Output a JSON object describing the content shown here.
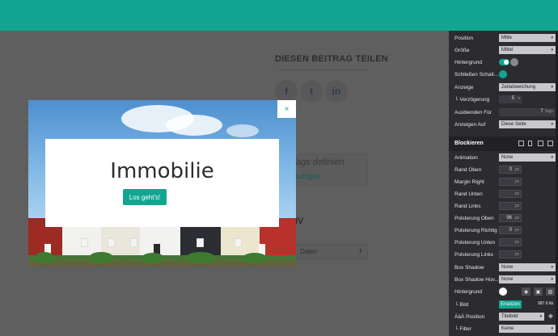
{
  "page": {
    "share_title": "DIESEN BEITRAG TEILEN",
    "social": [
      "f",
      "t",
      "in"
    ],
    "no_tags": "ne Tags definiert",
    "add_tags": "e hinzufügen",
    "section_iv": "IV",
    "select_value": "Daten",
    "select_arrow": "⇕"
  },
  "popup": {
    "title": "Immobilie",
    "cta": "Los geht's!",
    "close": "×"
  },
  "panel": {
    "rows": {
      "position": {
        "label": "Position",
        "value": "Mitte"
      },
      "size": {
        "label": "Größe",
        "value": "Mittel"
      },
      "background": {
        "label": "Hintergrund"
      },
      "close_btn": {
        "label": "Schließen Schalt..."
      },
      "display": {
        "label": "Anzeige",
        "value": "Zeitabweichung"
      },
      "delay": {
        "label": "└ Verzögerung",
        "value": "5",
        "unit": "s"
      },
      "hide_for": {
        "label": "Ausblenden Für",
        "value": "7",
        "unit": "Tags"
      },
      "show_on": {
        "label": "Anzeigen Auf",
        "value": "Diese Seite"
      }
    },
    "section": "Blockieren",
    "block_rows": {
      "animation": {
        "label": "Animation",
        "value": "None"
      },
      "margin_top": {
        "label": "Rand Oben",
        "value": "0",
        "unit": "px"
      },
      "margin_right": {
        "label": "Margin Right",
        "value": "",
        "unit": "px"
      },
      "margin_bottom": {
        "label": "Rand Unten",
        "value": "",
        "unit": "px"
      },
      "margin_left": {
        "label": "Rand Links",
        "value": "",
        "unit": "px"
      },
      "padding_top": {
        "label": "Polsterung Oben",
        "value": "96",
        "unit": "px"
      },
      "padding_right": {
        "label": "Polsterung Richtig",
        "value": "0",
        "unit": "px"
      },
      "padding_bottom": {
        "label": "Polsterung Unten",
        "value": "",
        "unit": "px"
      },
      "padding_left": {
        "label": "Polsterung Links",
        "value": "",
        "unit": "px"
      },
      "box_shadow": {
        "label": "Box Shadow",
        "value": "None"
      },
      "box_shadow_hover": {
        "label": "Box Shadow Hov...",
        "value": "None"
      },
      "bg": {
        "label": "Hintergrund"
      },
      "image": {
        "label": "└ Bild",
        "action": "Ersetzen",
        "size": "987.6 kb"
      },
      "bg_position": {
        "label": "ÄäÄ Position",
        "value": "Titelbild"
      },
      "filter": {
        "label": "└ Filter",
        "value": "Keine"
      }
    },
    "arrow": "▾"
  },
  "colors": {
    "accent": "#12a692",
    "panel": "#2c2c30",
    "overlay": "#5f5f5f"
  }
}
